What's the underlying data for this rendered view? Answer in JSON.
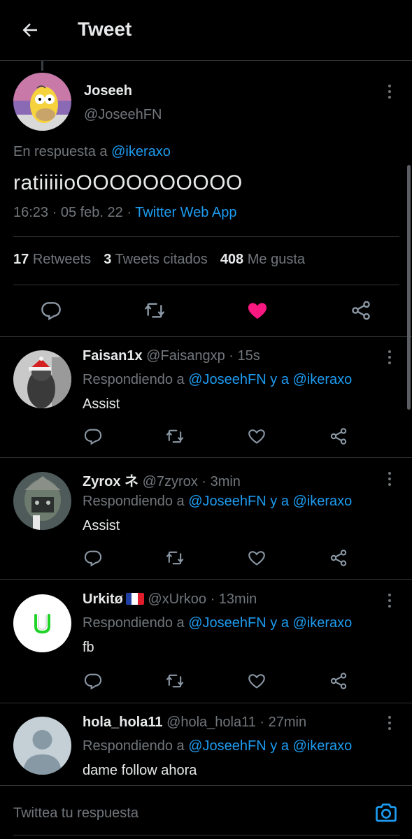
{
  "header": {
    "title": "Tweet"
  },
  "tweet": {
    "name": "Joseeh",
    "handle": "@JoseehFN",
    "reply_prefix": "En respuesta a",
    "reply_to": "@ikeraxo",
    "text": "ratiiiiioOOOOOOOOOO",
    "time": "16:23 · 05 feb. 22 ·",
    "source": "Twitter Web App",
    "stats": {
      "retweets_count": "17",
      "retweets_label": "Retweets",
      "quotes_count": "3",
      "quotes_label": "Tweets citados",
      "likes_count": "408",
      "likes_label": "Me gusta"
    },
    "liked": true,
    "like_color": "#f91880"
  },
  "replies": [
    {
      "name": "Faisan1x",
      "handle": "@Faisangxp · 15s",
      "prefix": "Respondiendo a",
      "mentions": "@JoseehFN y a @ikeraxo",
      "text": "Assist"
    },
    {
      "name": "Zyrox ネ",
      "handle": "@7zyrox · 3min",
      "prefix": "Respondiendo a",
      "mentions": "@JoseehFN y a @ikeraxo",
      "text": "Assist"
    },
    {
      "name": "Urkitø",
      "handle": "@xUrkoo · 13min",
      "prefix": "Respondiendo a",
      "mentions": "@JoseehFN y a @ikeraxo",
      "text": "fb",
      "flag": "french-flag"
    },
    {
      "name": "hola_hola11",
      "handle": "@hola_hola11 · 27min",
      "prefix": "Respondiendo a",
      "mentions": "@JoseehFN y a @ikeraxo",
      "text": "dame follow ahora"
    }
  ],
  "composer": {
    "placeholder": "Twittea tu respuesta"
  },
  "colors": {
    "accent": "#1d9bf0",
    "background": "#000000",
    "muted": "#71767b",
    "like": "#f91880"
  }
}
